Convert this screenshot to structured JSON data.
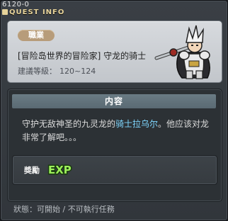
{
  "window": {
    "quest_id": "6120-0",
    "title": "QUEST INFO"
  },
  "job": {
    "badge": "職業",
    "quest_name": "[冒险岛世界的冒险家] 守龙的骑士",
    "rec_level_label": "建議等級：",
    "rec_level_value": "120~124",
    "npc_icon": "knight-npc-icon"
  },
  "content": {
    "header": "内容",
    "text_before": "守护无敌神圣的九灵龙的",
    "npc_name": "骑士拉乌尔",
    "text_after": "。他应该对龙非常了解吧。。。"
  },
  "reward": {
    "label": "奬勵",
    "exp_label": "EXP"
  },
  "status": {
    "label": "狀態：",
    "value": "可開始 / 不可執行任務"
  },
  "colors": {
    "title": "#e7d39a",
    "npc_name": "#7fd7ff",
    "exp": "#7ee84f",
    "badge": "#b79c7a"
  }
}
